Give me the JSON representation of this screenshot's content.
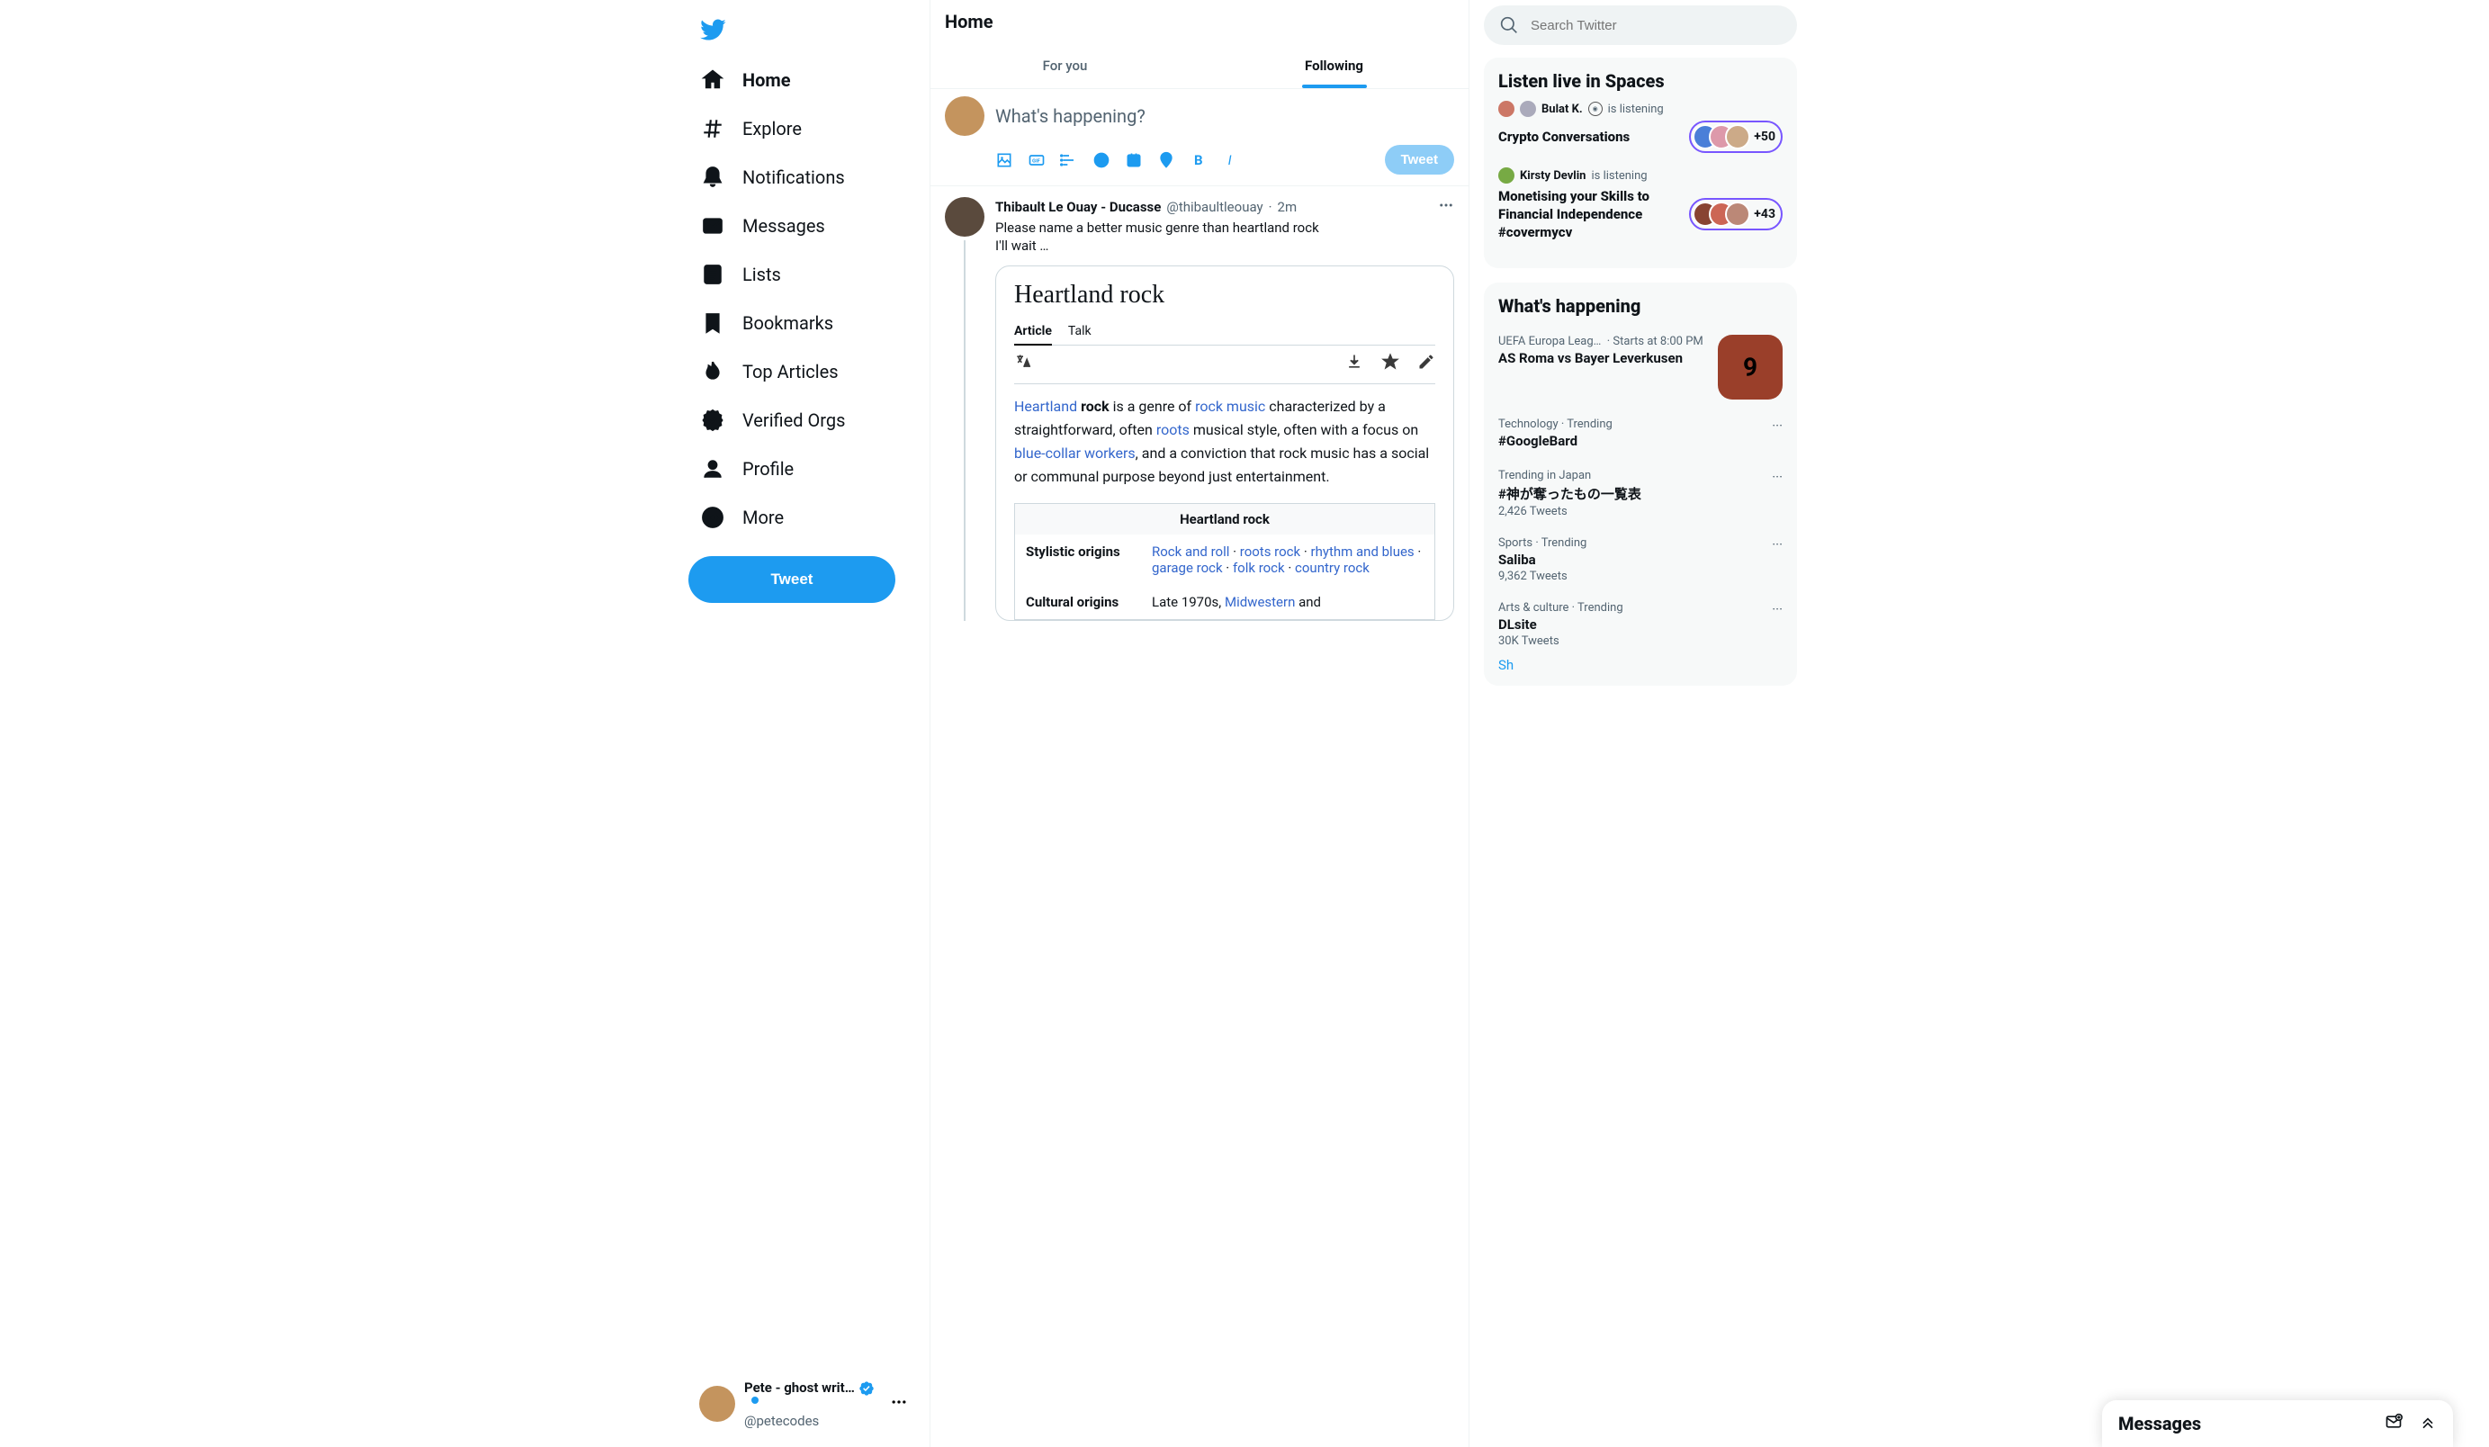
{
  "nav": {
    "items": [
      {
        "label": "Home"
      },
      {
        "label": "Explore"
      },
      {
        "label": "Notifications"
      },
      {
        "label": "Messages"
      },
      {
        "label": "Lists"
      },
      {
        "label": "Bookmarks"
      },
      {
        "label": "Top Articles"
      },
      {
        "label": "Verified Orgs"
      },
      {
        "label": "Profile"
      },
      {
        "label": "More"
      }
    ],
    "tweet": "Tweet"
  },
  "me": {
    "display": "Pete - ghost writ…",
    "handle": "@petecodes"
  },
  "main": {
    "title": "Home",
    "tabs": [
      "For you",
      "Following"
    ],
    "compose_placeholder": "What's happening?",
    "compose_tweet": "Tweet"
  },
  "post": {
    "author": "Thibault Le Ouay - Ducasse",
    "handle": "@thibaultleouay",
    "time": "2m",
    "line1": "Please name a better music genre than heartland rock",
    "line2": "I'll wait …"
  },
  "wiki": {
    "title": "Heartland rock",
    "tabs": [
      "Article",
      "Talk"
    ],
    "p_heartland": "Heartland",
    "p_rock": " rock",
    "p_1": " is a genre of ",
    "p_rockmusic": "rock music",
    "p_2": " characterized by a straightforward, often ",
    "p_roots": "roots",
    "p_3": " musical style, often with a focus on ",
    "p_bluecollar": "blue-collar workers",
    "p_4": ", and a conviction that rock music has a social or communal purpose beyond just entertainment.",
    "infobox_title": "Heartland rock",
    "row_stylistic": "Stylistic origins",
    "origins": [
      "Rock and roll",
      "roots rock",
      "rhythm and blues",
      "garage rock",
      "folk rock",
      "country rock"
    ],
    "row_cultural": "Cultural origins",
    "cultural_pre": "Late 1970s, ",
    "cultural_link": "Midwestern",
    "cultural_post": " and"
  },
  "search": {
    "placeholder": "Search Twitter"
  },
  "spaces": {
    "heading": "Listen live in Spaces",
    "items": [
      {
        "by": "Bulat K.",
        "action": "is listening",
        "title": "Crypto Conversations",
        "count": "+50"
      },
      {
        "by": "Kirsty Devlin",
        "action": "is listening",
        "title": "Monetising your Skills to Financial Independence #covermycv",
        "count": "+43"
      }
    ]
  },
  "happening": {
    "heading": "What's happening",
    "event": {
      "cat": "UEFA Europa Leag…",
      "sched": "Starts at 8:00 PM",
      "title": "AS Roma vs Bayer Leverkusen",
      "thumb_num": "9"
    },
    "trends": [
      {
        "cat": "Technology · Trending",
        "tag": "#GoogleBard",
        "cnt": ""
      },
      {
        "cat": "Trending in Japan",
        "tag": "#神が奪ったもの一覧表",
        "cnt": "2,426 Tweets"
      },
      {
        "cat": "Sports · Trending",
        "tag": "Saliba",
        "cnt": "9,362 Tweets"
      },
      {
        "cat": "Arts & culture · Trending",
        "tag": "DLsite",
        "cnt": "30K Tweets"
      }
    ],
    "more": "Sh"
  },
  "drawer": {
    "title": "Messages"
  }
}
